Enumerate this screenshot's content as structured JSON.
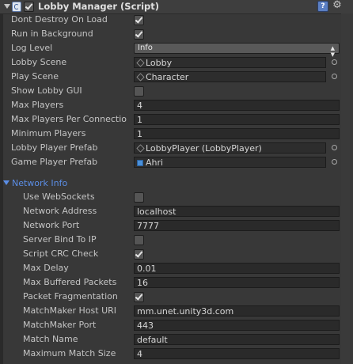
{
  "header": {
    "title": "Lobby Manager (Script)",
    "enabled": true
  },
  "fields": [
    {
      "label": "Dont Destroy On Load",
      "type": "checkbox",
      "checked": true
    },
    {
      "label": "Run in Background",
      "type": "checkbox",
      "checked": true
    },
    {
      "label": "Log Level",
      "type": "dropdown",
      "value": "Info"
    },
    {
      "label": "Lobby Scene",
      "type": "object",
      "value": "Lobby",
      "icon": "unity-scene-icon"
    },
    {
      "label": "Play Scene",
      "type": "object",
      "value": "Character",
      "icon": "unity-scene-icon"
    },
    {
      "label": "Show Lobby GUI",
      "type": "checkbox",
      "checked": false
    },
    {
      "label": "Max Players",
      "type": "text",
      "value": "4"
    },
    {
      "label": "Max Players Per Connectio",
      "type": "text",
      "value": "1"
    },
    {
      "label": "Minimum Players",
      "type": "text",
      "value": "1"
    },
    {
      "label": "Lobby Player Prefab",
      "type": "object",
      "value": "LobbyPlayer (LobbyPlayer)",
      "icon": "script-asset-icon"
    },
    {
      "label": "Game Player Prefab",
      "type": "object",
      "value": "Ahri",
      "icon": "prefab-icon"
    }
  ],
  "network_section": {
    "title": "Network Info",
    "fields": [
      {
        "label": "Use WebSockets",
        "type": "checkbox",
        "checked": false
      },
      {
        "label": "Network Address",
        "type": "text",
        "value": "localhost"
      },
      {
        "label": "Network Port",
        "type": "text",
        "value": "7777"
      },
      {
        "label": "Server Bind To IP",
        "type": "checkbox",
        "checked": false
      },
      {
        "label": "Script CRC Check",
        "type": "checkbox",
        "checked": true
      },
      {
        "label": "Max Delay",
        "type": "text",
        "value": "0.01"
      },
      {
        "label": "Max Buffered Packets",
        "type": "text",
        "value": "16"
      },
      {
        "label": "Packet Fragmentation",
        "type": "checkbox",
        "checked": true
      },
      {
        "label": "MatchMaker Host URI",
        "type": "text",
        "value": "mm.unet.unity3d.com"
      },
      {
        "label": "MatchMaker Port",
        "type": "text",
        "value": "443"
      },
      {
        "label": "Match Name",
        "type": "text",
        "value": "default"
      },
      {
        "label": "Maximum Match Size",
        "type": "text",
        "value": "4"
      }
    ]
  },
  "colors": {
    "panel_bg": "#383838",
    "field_bg": "#2a2a2a",
    "section_title": "#5b8ee6",
    "text": "#c4c4c4"
  }
}
